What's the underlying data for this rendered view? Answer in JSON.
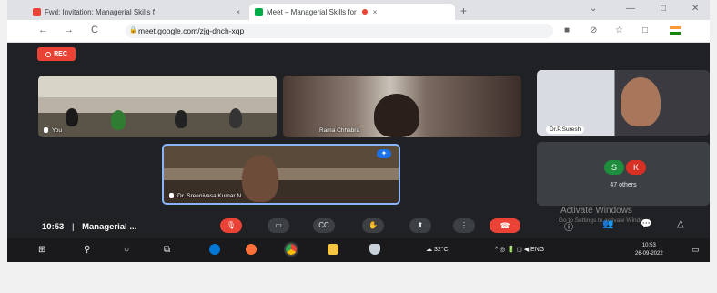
{
  "browser": {
    "tabs": [
      {
        "title": "Fwd: Invitation: Managerial Skills f",
        "close": "×",
        "favicon_color": "#ea4335"
      },
      {
        "title": "Meet – Managerial Skills for",
        "close": "×",
        "favicon_color": "#00ac47"
      }
    ],
    "new_tab": "+",
    "window_controls": [
      "⌄",
      "—",
      "□",
      "✕"
    ],
    "nav": {
      "back": "←",
      "forward": "→",
      "reload": "C"
    },
    "url": "meet.google.com/zjg-dnch-xqp",
    "toolbar_icons": [
      "■",
      "⊘",
      "☆",
      "□"
    ]
  },
  "meet": {
    "rec_label": "REC",
    "tiles": [
      {
        "name": "You"
      },
      {
        "name": "Rama Chhabra"
      },
      {
        "name": "Dr.P.Suresh"
      },
      {
        "name": "Dr. Sreenivasa Kumar N"
      }
    ],
    "others": {
      "avatars": [
        {
          "letter": "S",
          "color": "#1e8e3e"
        },
        {
          "letter": "K",
          "color": "#d93025"
        }
      ],
      "label": "47 others"
    },
    "time": "10:53",
    "separator": "|",
    "meeting_title": "Managerial ...",
    "controls": {
      "mic": "🎙",
      "camera": "▭",
      "captions": "CC",
      "hand": "✋",
      "present": "⬆",
      "more": "⋮",
      "end": "☎"
    },
    "right_icons": [
      "ⓘ",
      "👥",
      "💬",
      "△"
    ]
  },
  "watermark": {
    "title": "Activate Windows",
    "subtitle": "Go to Settings to activate Windows."
  },
  "taskbar": {
    "start": "⊞",
    "search": "⚲",
    "cortana": "○",
    "taskview": "⧉",
    "weather": "32°C",
    "tray": "^ ◎ 🔋 ◻ ◀ ENG",
    "clock_time": "10:53",
    "clock_date": "26-09-2022",
    "notification": "▭"
  }
}
